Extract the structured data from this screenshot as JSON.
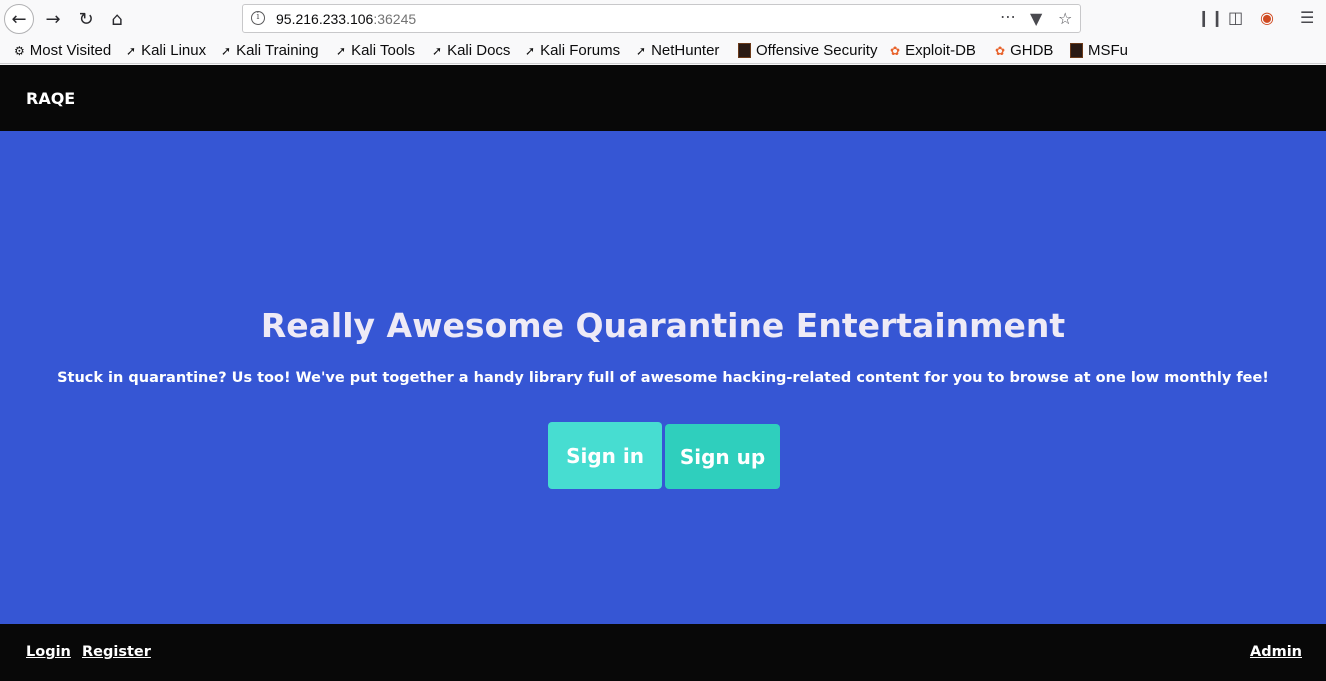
{
  "browser": {
    "url_host": "95.216.233.106",
    "url_port": ":36245",
    "bookmarks": [
      {
        "label": "Most Visited",
        "icon": "gear-icon"
      },
      {
        "label": "Kali Linux",
        "icon": "kali-icon"
      },
      {
        "label": "Kali Training",
        "icon": "kali-icon"
      },
      {
        "label": "Kali Tools",
        "icon": "kali-icon"
      },
      {
        "label": "Kali Docs",
        "icon": "kali-icon"
      },
      {
        "label": "Kali Forums",
        "icon": "kali-icon"
      },
      {
        "label": "NetHunter",
        "icon": "kali-icon"
      },
      {
        "label": "Offensive Security",
        "icon": "offsec-icon"
      },
      {
        "label": "Exploit-DB",
        "icon": "exploitdb-icon"
      },
      {
        "label": "GHDB",
        "icon": "exploitdb-icon"
      },
      {
        "label": "MSFu",
        "icon": "offsec-icon"
      }
    ]
  },
  "site": {
    "brand": "RAQE",
    "hero_title": "Really Awesome Quarantine Entertainment",
    "hero_subtitle": "Stuck in quarantine? Us too! We've put together a handy library full of awesome hacking-related content for you to browse at one low monthly fee!",
    "signin_label": "Sign in",
    "signup_label": "Sign up",
    "footer": {
      "login": "Login",
      "register": "Register",
      "admin": "Admin"
    }
  },
  "colors": {
    "hero_bg": "#3656d4",
    "nav_bg": "#080808",
    "signin_bg": "#47ddd1",
    "signup_bg": "#2fcfbd"
  }
}
